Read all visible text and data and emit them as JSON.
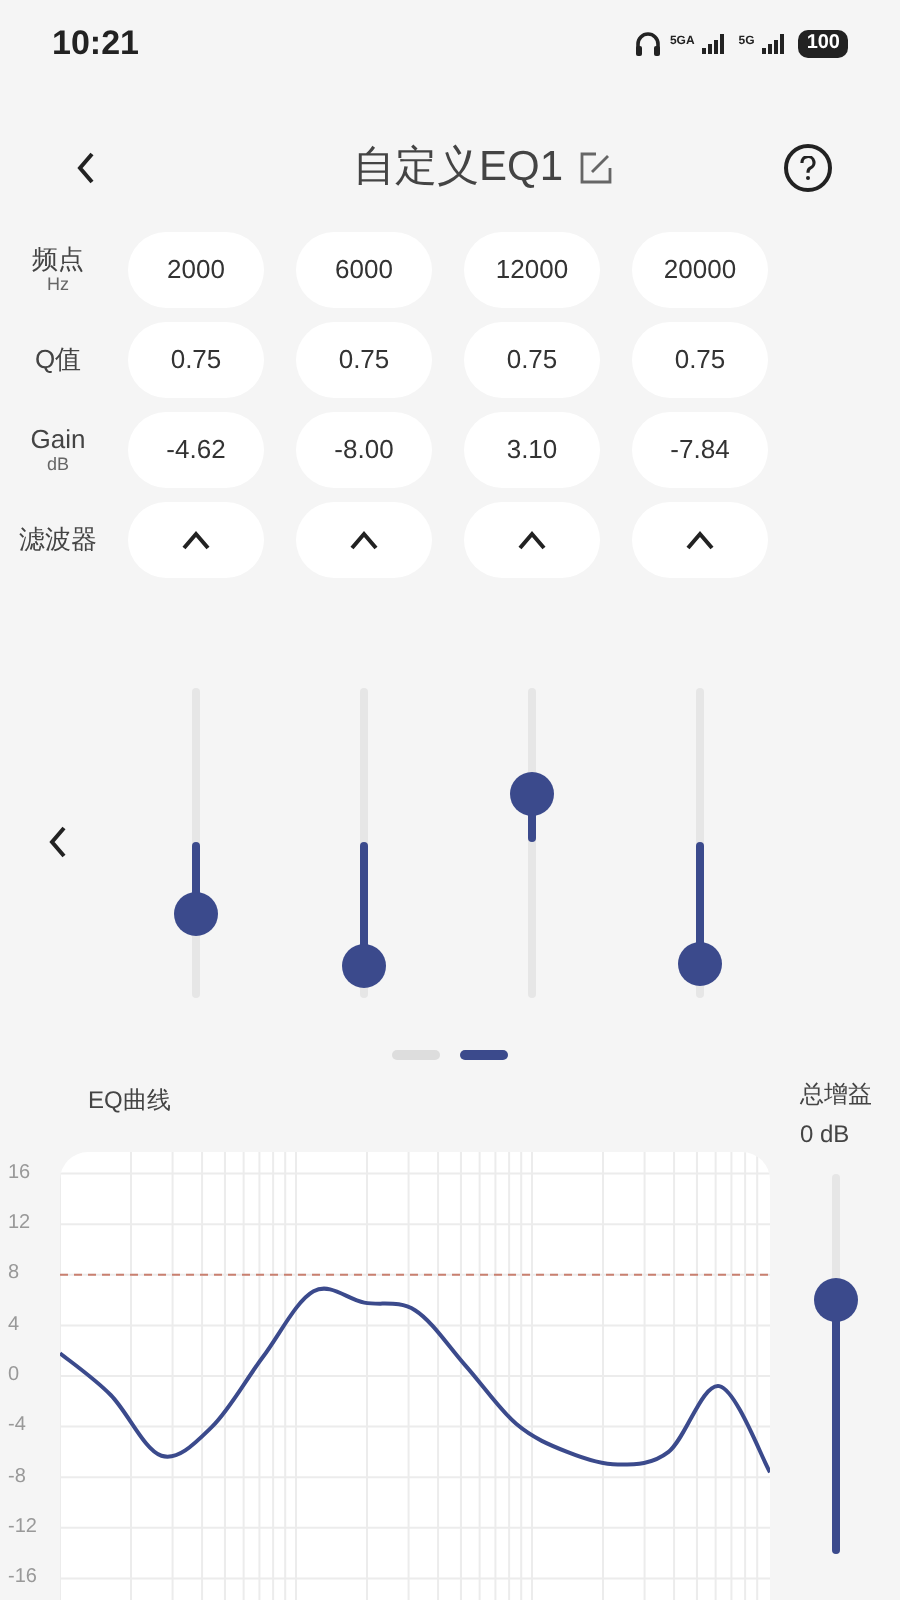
{
  "status_bar": {
    "time": "10:21",
    "network_1": "5GA",
    "network_2": "5G",
    "battery": "100"
  },
  "header": {
    "title": "自定义EQ1"
  },
  "params": {
    "rows": [
      {
        "label": "频点",
        "unit": "Hz",
        "kind": "text",
        "values": [
          "2000",
          "6000",
          "12000",
          "20000"
        ]
      },
      {
        "label": "Q值",
        "kind": "text",
        "values": [
          "0.75",
          "0.75",
          "0.75",
          "0.75"
        ]
      },
      {
        "label": "Gain",
        "unit": "dB",
        "kind": "text",
        "values": [
          "-4.62",
          "-8.00",
          "3.10",
          "-7.84"
        ]
      },
      {
        "label": "滤波器",
        "kind": "filter",
        "cells": [
          {
            "kind": "peak"
          },
          {
            "kind": "peak"
          },
          {
            "kind": "peak"
          },
          {
            "kind": "peak"
          }
        ]
      }
    ]
  },
  "band_sliders": [
    {
      "level": 0.269
    },
    {
      "level": 0.1
    },
    {
      "level": 0.655
    },
    {
      "level": 0.108
    }
  ],
  "pager": [
    {
      "selected": false
    },
    {
      "selected": true
    }
  ],
  "eq_curve": {
    "title": "EQ曲线",
    "chart_data": {
      "type": "line",
      "ylim": [
        -17.7,
        17.7
      ],
      "yticks": [
        16,
        12,
        8,
        4,
        0,
        -4,
        -8,
        -12,
        -16
      ],
      "grid": true,
      "series": [
        {
          "color": "#3b4a8c",
          "values": [
            1.8,
            -1.5,
            -6.3,
            -4,
            1.5,
            6.7,
            5.8,
            5.2,
            0.8,
            -3.8,
            -6,
            -7,
            -6,
            -0.8,
            -7.6
          ]
        }
      ],
      "ref_lines": [
        {
          "axis": "y",
          "value": 8,
          "color": "#c98070"
        }
      ]
    }
  },
  "total_gain": {
    "label": "总增益",
    "reading": "0 dB",
    "level": 0.67
  }
}
